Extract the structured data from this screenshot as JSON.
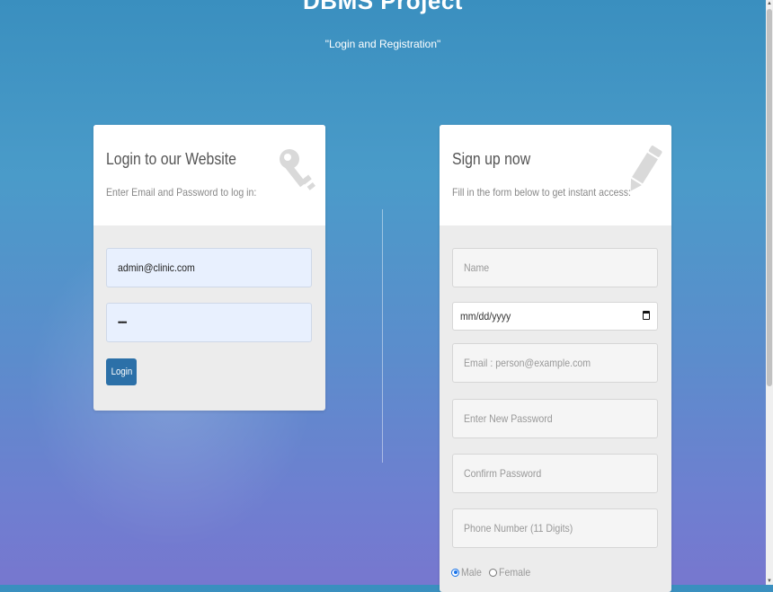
{
  "header": {
    "title": "DBMS Project",
    "subtitle": "\"Login and Registration\""
  },
  "login": {
    "title": "Login to our Website",
    "description": "Enter Email and Password to log in:",
    "icon": "key-icon",
    "email_value": "admin@clinic.com",
    "password_value": "•••••",
    "button_label": "Login"
  },
  "signup": {
    "title": "Sign up now",
    "description": "Fill in the form below to get instant access:",
    "icon": "pencil-icon",
    "name_placeholder": "Name",
    "date_placeholder": "mm/dd/yyyy",
    "email_placeholder": "Email : person@example.com",
    "new_password_placeholder": "Enter New Password",
    "confirm_password_placeholder": "Confirm Password",
    "phone_placeholder": "Phone Number (11 Digits)",
    "gender_male": "Male",
    "gender_female": "Female",
    "gender_selected": "Male"
  },
  "colors": {
    "button": "#2c70a8",
    "radio_selected": "#1a73e8",
    "autofill": "#e8f0fe"
  }
}
